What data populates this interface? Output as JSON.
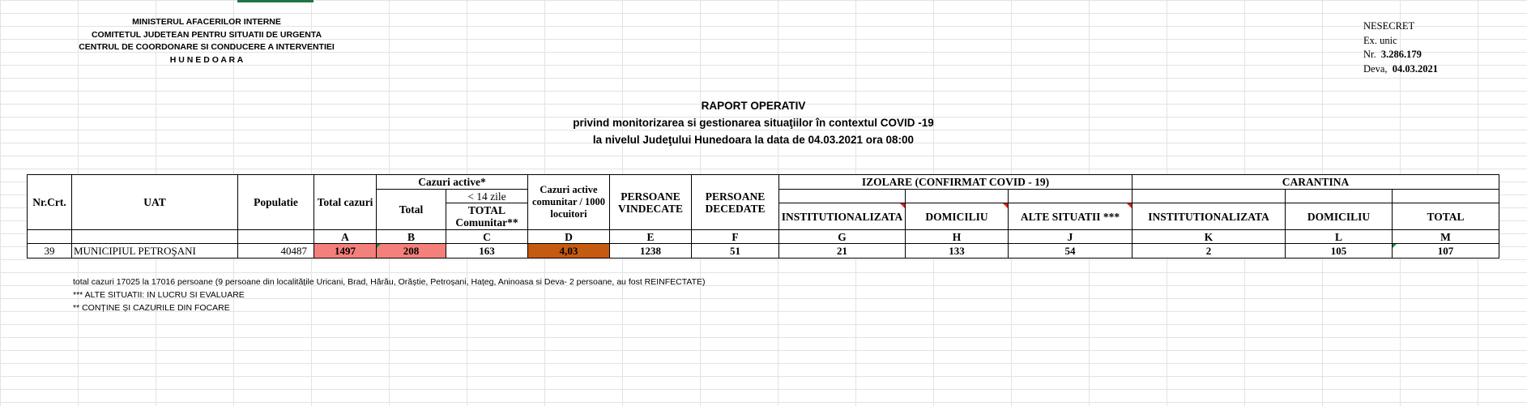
{
  "header": {
    "ministry_lines": [
      "MINISTERUL AFACERILOR INTERNE",
      "COMITETUL JUDETEAN PENTRU SITUATII DE URGENTA",
      "CENTRUL DE COORDONARE SI CONDUCERE A INTERVENTIEI",
      "H U N E D O A R A"
    ],
    "classification": "NESECRET",
    "copy": "Ex. unic",
    "nr_label": "Nr.",
    "nr_value": "3.286.179",
    "place_label": "Deva,",
    "date_value": "04.03.2021"
  },
  "title": {
    "line1": "RAPORT OPERATIV",
    "line2": "privind  monitorizarea si gestionarea situaţiilor în contextul COVID -19",
    "line3": "la nivelul Judeţului Hunedoara la data de 04.03.2021 ora 08:00"
  },
  "table": {
    "col_nr": "Nr.Crt.",
    "col_uat": "UAT",
    "col_pop": "Populatie",
    "col_total": "Total cazuri",
    "cazuri_active": "Cazuri active*",
    "ca_total": "Total",
    "ca_14": "< 14 zile",
    "ca_comunitar": "TOTAL Comunitar**",
    "col_rate": "Cazuri active comunitar / 1000 locuitori",
    "col_vindecate": "PERSOANE VINDECATE",
    "col_decedate": "PERSOANE DECEDATE",
    "izolare": "IZOLARE (CONFIRMAT COVID - 19)",
    "iz_inst": "INSTITUTIONALIZATA",
    "iz_dom": "DOMICILIU",
    "iz_alte": "ALTE SITUATII ***",
    "carantina": "CARANTINA",
    "car_inst": "INSTITUTIONALIZATA",
    "car_dom": "DOMICILIU",
    "car_total": "TOTAL",
    "letters": [
      "A",
      "B",
      "C",
      "D",
      "E",
      "F",
      "G",
      "H",
      "J",
      "K",
      "L",
      "M"
    ],
    "row": {
      "nr": "39",
      "uat": "MUNICIPIUL PETROŞANI",
      "pop": "40487",
      "total": "1497",
      "active_total": "208",
      "comunitar": "163",
      "rate": "4,03",
      "vindecate": "1238",
      "decedate": "51",
      "iz_inst": "21",
      "iz_dom": "133",
      "iz_alte": "54",
      "car_inst": "2",
      "car_dom": "105",
      "car_total": "107"
    },
    "colors": {
      "total_bg": "#f4807b",
      "active_bg": "#f4807b",
      "rate_bg": "#c55a11"
    }
  },
  "notes": [
    "total cazuri 17025 la 17016  persoane (9  persoane din localitățile Uricani, Brad, Hărău, Orăștie, Petroșani, Hațeg,  Aninoasa si Deva- 2 persoane, au fost REINFECTATE)",
    "*** ALTE SITUATII: IN LUCRU SI EVALUARE",
    "** CONȚINE ȘI CAZURILE DIN FOCARE"
  ]
}
